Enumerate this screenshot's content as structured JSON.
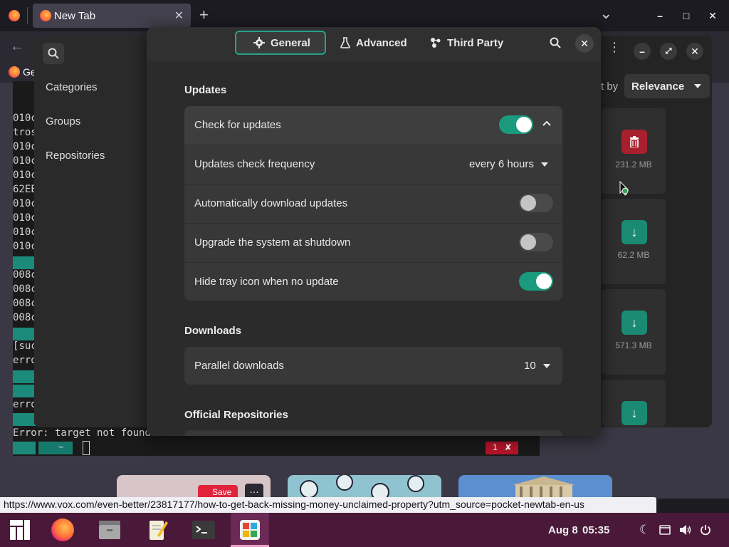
{
  "browser": {
    "tab_title": "New Tab",
    "tab_close": "✕",
    "new_tab": "+",
    "list_tabs": "⌄",
    "window_min": "–",
    "window_max": "□",
    "window_close": "✕",
    "back": "←",
    "bookmark_partial": "Ge",
    "status_url": "https://www.vox.com/even-better/23817177/how-to-get-back-missing-money-unclaimed-property?utm_source=pocket-newtab-en-us",
    "pocket_save": "Save",
    "pocket_more": "…"
  },
  "terminal": {
    "lines": [
      {
        "text": "010c",
        "kind": "out"
      },
      {
        "text": "tros",
        "kind": "out"
      },
      {
        "text": "010c",
        "kind": "out"
      },
      {
        "text": "010c",
        "kind": "out"
      },
      {
        "text": "010c",
        "kind": "out"
      },
      {
        "text": "62EE",
        "kind": "out"
      },
      {
        "text": "010c",
        "kind": "out"
      },
      {
        "text": "010c",
        "kind": "out"
      },
      {
        "text": "010c",
        "kind": "out"
      },
      {
        "text": "010c",
        "kind": "out"
      },
      {
        "text": "",
        "kind": "badge"
      },
      {
        "text": "008c",
        "kind": "out"
      },
      {
        "text": "008c",
        "kind": "out"
      },
      {
        "text": "008c",
        "kind": "out"
      },
      {
        "text": "008c",
        "kind": "out"
      },
      {
        "text": "",
        "kind": "badge"
      },
      {
        "text": "[suc",
        "kind": "out"
      },
      {
        "text": "erro",
        "kind": "out"
      }
    ],
    "error_line": "Error: target not found: ",
    "home_segment": "~",
    "exit_code": "1",
    "exit_mark": "✘"
  },
  "software": {
    "sidebar": {
      "items": [
        "Categories",
        "Groups",
        "Repositories"
      ]
    },
    "sort_label_partial": "t by",
    "sort_value": "Relevance",
    "packages": [
      {
        "size": "231.2 MB",
        "action": "remove",
        "color": "#a8202e"
      },
      {
        "size": "62.2 MB",
        "action": "install",
        "color": "#1b8a72"
      },
      {
        "size": "571.3 MB",
        "action": "install",
        "color": "#1b8a72"
      },
      {
        "size": "",
        "action": "install",
        "color": "#1b8a72"
      }
    ]
  },
  "preferences": {
    "tabs": [
      {
        "label": "General",
        "icon": "gear-icon",
        "active": true
      },
      {
        "label": "Advanced",
        "icon": "flask-icon",
        "active": false
      },
      {
        "label": "Third Party",
        "icon": "puzzle-icon",
        "active": false
      }
    ],
    "close": "✕",
    "updates": {
      "title": "Updates",
      "check_for_updates": {
        "label": "Check for updates",
        "on": true
      },
      "frequency": {
        "label": "Updates check frequency",
        "value": "every 6 hours"
      },
      "auto_download": {
        "label": "Automatically download updates",
        "on": false
      },
      "upgrade_shutdown": {
        "label": "Upgrade the system at shutdown",
        "on": false
      },
      "hide_tray": {
        "label": "Hide tray icon when no update",
        "on": true
      }
    },
    "downloads": {
      "title": "Downloads",
      "parallel": {
        "label": "Parallel downloads",
        "value": "10"
      }
    },
    "repos": {
      "title": "Official Repositories"
    }
  },
  "taskbar": {
    "date": "Aug 8",
    "time": "05:35"
  },
  "colors": {
    "accent": "#1a9b7d",
    "danger": "#a8202e",
    "taskbar": "#4a1838"
  }
}
